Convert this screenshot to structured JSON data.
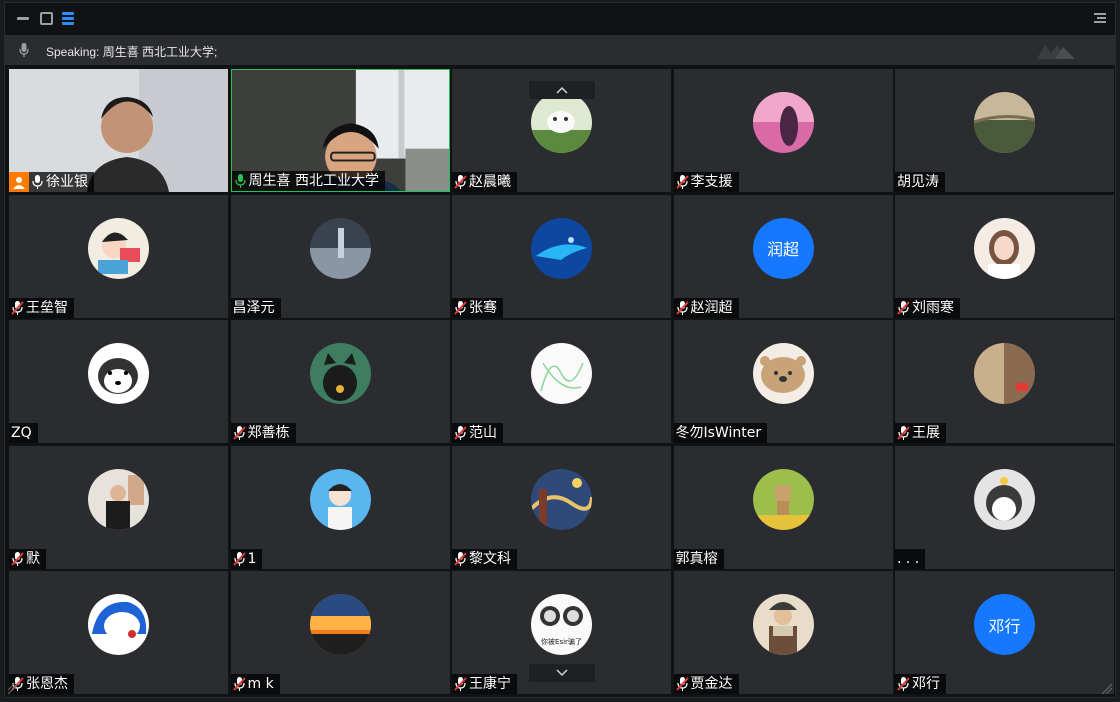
{
  "speaking": {
    "text": "Speaking: 周生喜 西北工业大学;"
  },
  "colors": {
    "accent": "#2f8cff",
    "active_border": "#27c15a",
    "muted_mic": "#e03c3c",
    "host": "#ff7a00",
    "text_avatar": "#1677ff"
  },
  "participants": [
    {
      "name": "徐业银",
      "mic": "live",
      "host": true,
      "video": true
    },
    {
      "name": "周生喜 西北工业大学",
      "mic": "live",
      "video": true,
      "speaking": true
    },
    {
      "name": "赵晨曦",
      "mic": "muted",
      "avatar": "dog-icon"
    },
    {
      "name": "李支援",
      "mic": "muted",
      "avatar": "silhouette-pink"
    },
    {
      "name": "胡见涛",
      "mic": "none",
      "avatar": "landscape"
    },
    {
      "name": "王垒智",
      "mic": "muted",
      "avatar": "cartoon"
    },
    {
      "name": "昌泽元",
      "mic": "none",
      "avatar": "mist"
    },
    {
      "name": "张骞",
      "mic": "muted",
      "avatar": "ocean"
    },
    {
      "name": "赵润超",
      "mic": "muted",
      "avatar_text": "润超"
    },
    {
      "name": "刘雨寒",
      "mic": "muted",
      "avatar": "girl"
    },
    {
      "name": "ZQ",
      "mic": "none",
      "avatar": "husky-cartoon"
    },
    {
      "name": "郑善栋",
      "mic": "muted",
      "avatar": "black-cat"
    },
    {
      "name": "范山",
      "mic": "muted",
      "avatar": "sketch"
    },
    {
      "name": "冬勿IsWinter",
      "mic": "none",
      "avatar": "bear"
    },
    {
      "name": "王展",
      "mic": "muted",
      "avatar": "photo-brown"
    },
    {
      "name": "默",
      "mic": "muted",
      "avatar": "man-photo"
    },
    {
      "name": "1",
      "mic": "muted",
      "avatar": "boy-blue"
    },
    {
      "name": "黎文科",
      "mic": "muted",
      "avatar": "starry-night"
    },
    {
      "name": "郭真榕",
      "mic": "none",
      "avatar": "box-figure"
    },
    {
      "name": ". . .",
      "mic": "none",
      "avatar": "husky-photo"
    },
    {
      "name": "张恩杰",
      "mic": "muted",
      "avatar": "doraemon"
    },
    {
      "name": "m k",
      "mic": "muted",
      "avatar": "sunset"
    },
    {
      "name": "王康宁",
      "mic": "muted",
      "avatar": "meme",
      "avatar_caption": "你被Esir骗了"
    },
    {
      "name": "贾金达",
      "mic": "muted",
      "avatar": "warrior"
    },
    {
      "name": "邓行",
      "mic": "muted",
      "avatar_text": "邓行"
    }
  ]
}
